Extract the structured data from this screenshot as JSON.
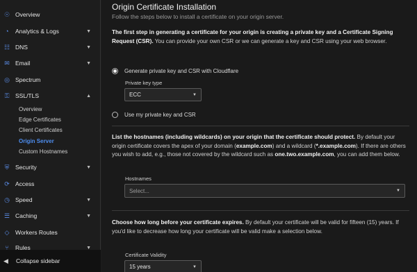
{
  "sidebar": {
    "items": [
      {
        "label": "Overview",
        "icon": "☉"
      },
      {
        "label": "Analytics & Logs",
        "icon": "◔"
      },
      {
        "label": "DNS",
        "icon": "☷"
      },
      {
        "label": "Email",
        "icon": "✉"
      },
      {
        "label": "Spectrum",
        "icon": "◎"
      },
      {
        "label": "SSL/TLS",
        "icon": "⚿"
      }
    ],
    "ssl_sub": [
      "Overview",
      "Edge Certificates",
      "Client Certificates",
      "Origin Server",
      "Custom Hostnames"
    ],
    "items2": [
      {
        "label": "Security",
        "icon": "⛨"
      },
      {
        "label": "Access",
        "icon": "⟳"
      },
      {
        "label": "Speed",
        "icon": "◷"
      },
      {
        "label": "Caching",
        "icon": "☰"
      },
      {
        "label": "Workers Routes",
        "icon": "◇"
      },
      {
        "label": "Rules",
        "icon": "⑂"
      }
    ],
    "collapse_label": "Collapse sidebar",
    "collapse_icon": "◀"
  },
  "main": {
    "title": "Origin Certificate Installation",
    "subtitle": "Follow the steps below to install a certificate on your origin server.",
    "step1_bold": "The first step in generating a certificate for your origin is creating a private key and a Certificate Signing Request (CSR).",
    "step1_rest": " You can provide your own CSR or we can generate a key and CSR using your web browser.",
    "radio_generate": "Generate private key and CSR with Cloudflare",
    "key_type_label": "Private key type",
    "key_type_value": "ECC",
    "radio_own": "Use my private key and CSR",
    "hostnames_bold": "List the hostnames (including wildcards) on your origin that the certificate should protect.",
    "hostnames_a": " By default your origin certificate covers the apex of your domain (",
    "hostnames_apex": "example.com",
    "hostnames_b": ") and a wildcard (",
    "hostnames_wild": "*.example.com",
    "hostnames_c": "). If there are others you wish to add, e.g., those not covered by the wildcard such as ",
    "hostnames_sub": "one.two.example.com",
    "hostnames_d": ", you can add them below.",
    "hostnames_label": "Hostnames",
    "hostnames_placeholder": "Select...",
    "expiry_bold": "Choose how long before your certificate expires.",
    "expiry_rest": " By default your certificate will be valid for fifteen (15) years. If you'd like to decrease how long your certificate will be valid make a selection below.",
    "validity_label": "Certificate Validity",
    "validity_value": "15 years"
  }
}
